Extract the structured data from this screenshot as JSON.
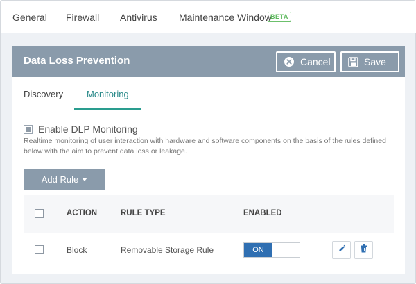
{
  "top_tabs": [
    "General",
    "Firewall",
    "Antivirus",
    "Maintenance Window"
  ],
  "beta_badge": "BETA",
  "panel": {
    "title": "Data Loss Prevention",
    "cancel_label": "Cancel",
    "save_label": "Save"
  },
  "sub_tabs": [
    "Discovery",
    "Monitoring"
  ],
  "active_sub_tab": "Monitoring",
  "enable_label": "Enable DLP Monitoring",
  "enable_checked": true,
  "description": "Realtime monitoring of user interaction with hardware and software components on the basis of the rules defined below with the aim to prevent data loss or leakage.",
  "add_rule_label": "Add Rule",
  "table": {
    "headers": [
      "ACTION",
      "RULE TYPE",
      "ENABLED"
    ],
    "rows": [
      {
        "action": "Block",
        "rule_type": "Removable Storage Rule",
        "enabled": "ON"
      }
    ]
  },
  "colors": {
    "header_bg": "#8a9bab",
    "accent_teal": "#2a9d8f",
    "toggle_on": "#2f6fb2",
    "beta_green": "#5bb85b"
  },
  "icons": {
    "cancel": "close-circle-icon",
    "save": "floppy-disk-icon",
    "edit": "pencil-icon",
    "delete": "trash-icon",
    "add_rule_caret": "caret-down-icon"
  }
}
